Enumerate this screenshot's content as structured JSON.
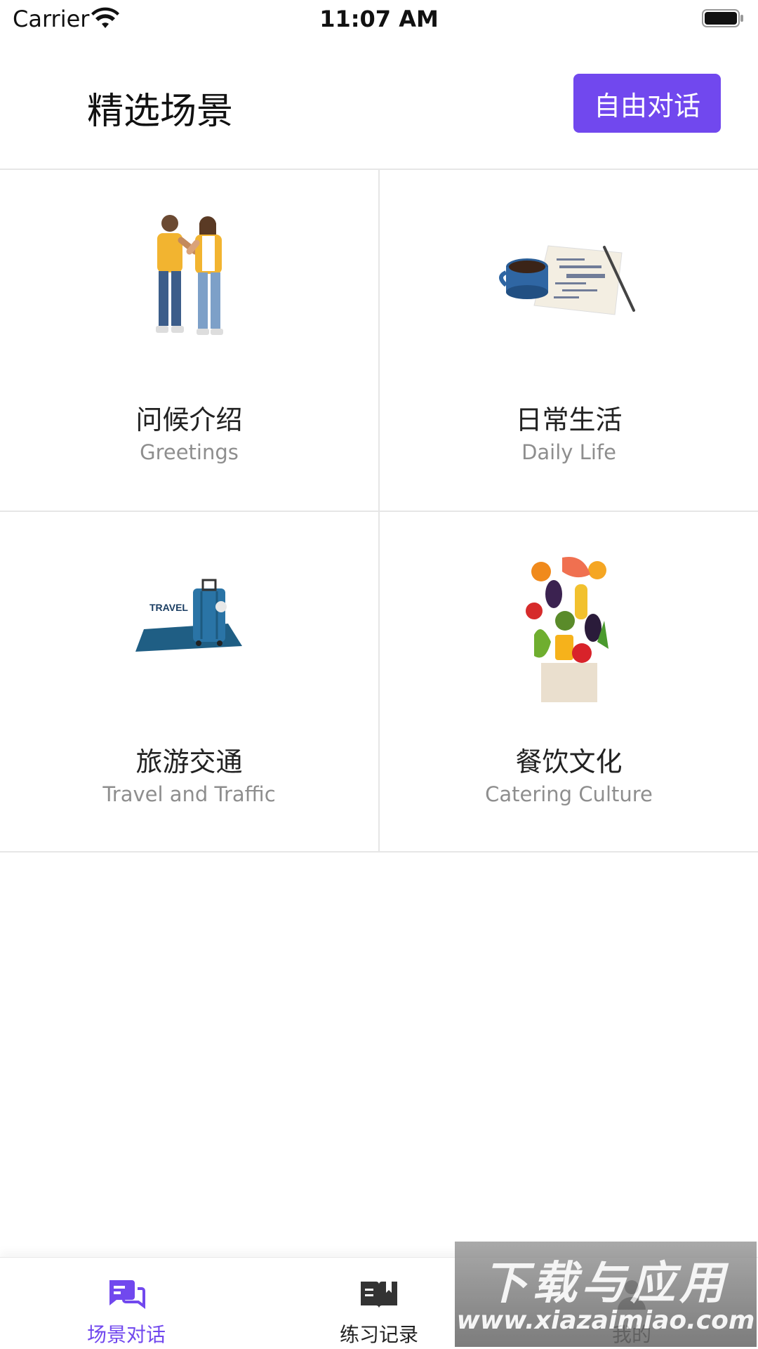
{
  "status_bar": {
    "carrier": "Carrier",
    "time": "11:07 AM"
  },
  "header": {
    "title": "精选场景",
    "free_button": "自由对话"
  },
  "scenes": [
    {
      "cn": "问候介绍",
      "en": "Greetings",
      "image": "two-people-fistbump"
    },
    {
      "cn": "日常生活",
      "en": "Daily Life",
      "image": "coffee-cup-and-napkin"
    },
    {
      "cn": "旅游交通",
      "en": "Travel and Traffic",
      "image": "suitcase-passport"
    },
    {
      "cn": "餐饮文化",
      "en": "Catering Culture",
      "image": "grocery-bag-vegetables"
    }
  ],
  "tabs": [
    {
      "label": "场景对话",
      "icon": "chat-bubbles-icon",
      "active": true
    },
    {
      "label": "练习记录",
      "icon": "open-book-icon",
      "active": false
    },
    {
      "label": "我的",
      "icon": "person-icon",
      "active": false
    }
  ],
  "watermark": {
    "line1": "下载与应用",
    "line2": "www.xiazaimiao.com"
  },
  "colors": {
    "accent": "#7148ee",
    "divider": "#e6e6e6",
    "subtitle": "#8e8e8e"
  }
}
